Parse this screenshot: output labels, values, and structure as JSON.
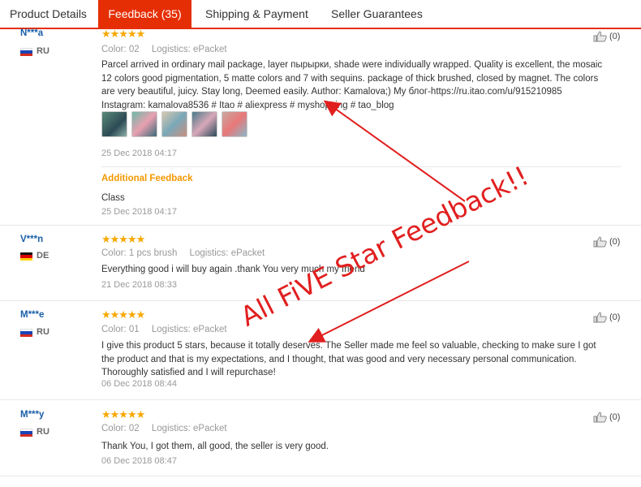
{
  "tabs": [
    {
      "label": "Product Details"
    },
    {
      "label": "Feedback (35)"
    },
    {
      "label": "Shipping & Payment"
    },
    {
      "label": "Seller Guarantees"
    }
  ],
  "reviews": [
    {
      "user": "N***a",
      "country": "RU",
      "stars": "★★★★★",
      "color_label": "Color:",
      "color_value": "02",
      "logistics_label": "Logistics:",
      "logistics_value": "ePacket",
      "text": "Parcel arrived in ordinary mail package, layer пырырки, shade were individually wrapped. Quality is excellent, the mosaic 12 colors good pigmentation, 5 matte colors and 7 with sequins. package of thick brushed, closed by magnet. The colors are very beautiful, juicy. Stay long, Deemed easily. Author: Kamalova;) My блог-https://ru.itao.com/u/915210985 Instagram: kamalova8536 # Itao # aliexpress # myshopping # tao_blog",
      "date": "25 Dec 2018 04:17",
      "additional_label": "Additional Feedback",
      "additional_text": "Class",
      "additional_date": "25 Dec 2018 04:17",
      "helpful": "(0)"
    },
    {
      "user": "V***n",
      "country": "DE",
      "stars": "★★★★★",
      "color_label": "Color:",
      "color_value": "1 pcs brush",
      "logistics_label": "Logistics:",
      "logistics_value": "ePacket",
      "text": "Everything good i will buy again .thank You very much my friend",
      "date": "21 Dec 2018 08:33",
      "helpful": "(0)"
    },
    {
      "user": "M***e",
      "country": "RU",
      "stars": "★★★★★",
      "color_label": "Color:",
      "color_value": "01",
      "logistics_label": "Logistics:",
      "logistics_value": "ePacket",
      "text": "I give this product 5 stars, because it totally deserves. The Seller made me feel so valuable, checking to make sure I got the product and that is my expectations, and I thought, that was good and very necessary personal communication. Thoroughly satisfied and I will repurchase!",
      "date": "06 Dec 2018 08:44",
      "helpful": "(0)"
    },
    {
      "user": "M***y",
      "country": "RU",
      "stars": "★★★★★",
      "color_label": "Color:",
      "color_value": "02",
      "logistics_label": "Logistics:",
      "logistics_value": "ePacket",
      "text": "Thank You, I got them, all good, the seller is very good.",
      "date": "06 Dec 2018 08:47",
      "helpful": "(0)"
    }
  ],
  "overlay": {
    "text": "All FiVE Star Feedback!!"
  },
  "colors": {
    "accent": "#e62e04",
    "star": "#f7a800",
    "username": "#1a5ea8",
    "additional": "#f39800",
    "annotation": "#e11f1f"
  }
}
